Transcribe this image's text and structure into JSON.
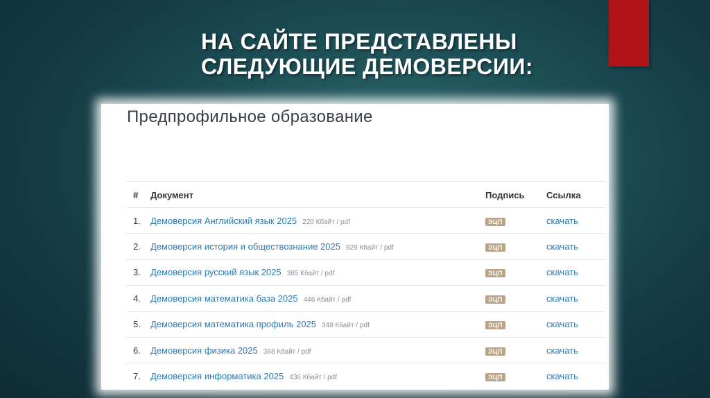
{
  "slide": {
    "title_line1": "НА САЙТЕ ПРЕДСТАВЛЕНЫ",
    "title_line2": "СЛЕДУЮЩИЕ ДЕМОВЕРСИИ:",
    "accent_color": "#b01416"
  },
  "page": {
    "heading": "Предпрофильное образование",
    "columns": [
      "#",
      "Документ",
      "Подпись",
      "Ссылка"
    ],
    "rows": [
      {
        "num": "1.",
        "title": "Демоверсия Английский язык 2025",
        "size": "220 Кбайт / pdf",
        "badge": "ЭЦП",
        "link": "скачать"
      },
      {
        "num": "2.",
        "title": "Демоверсия история и обществознание 2025",
        "size": "929 Кбайт / pdf",
        "badge": "ЭЦП",
        "link": "скачать"
      },
      {
        "num": "3.",
        "title": "Демоверсия русский язык 2025",
        "size": "385 Кбайт / pdf",
        "badge": "ЭЦП",
        "link": "скачать"
      },
      {
        "num": "4.",
        "title": "Демоверсия математика база 2025",
        "size": "446 Кбайт / pdf",
        "badge": "ЭЦП",
        "link": "скачать"
      },
      {
        "num": "5.",
        "title": "Демоверсия математика профиль 2025",
        "size": "348 Кбайт / pdf",
        "badge": "ЭЦП",
        "link": "скачать"
      },
      {
        "num": "6.",
        "title": "Демоверсия физика 2025",
        "size": "368 Кбайт / pdf",
        "badge": "ЭЦП",
        "link": "скачать"
      },
      {
        "num": "7.",
        "title": "Демоверсия информатика 2025",
        "size": "436 Кбайт / pdf",
        "badge": "ЭЦП",
        "link": "скачать"
      }
    ],
    "link_color": "#2a7ab4",
    "badge_color": "#b9a488"
  }
}
